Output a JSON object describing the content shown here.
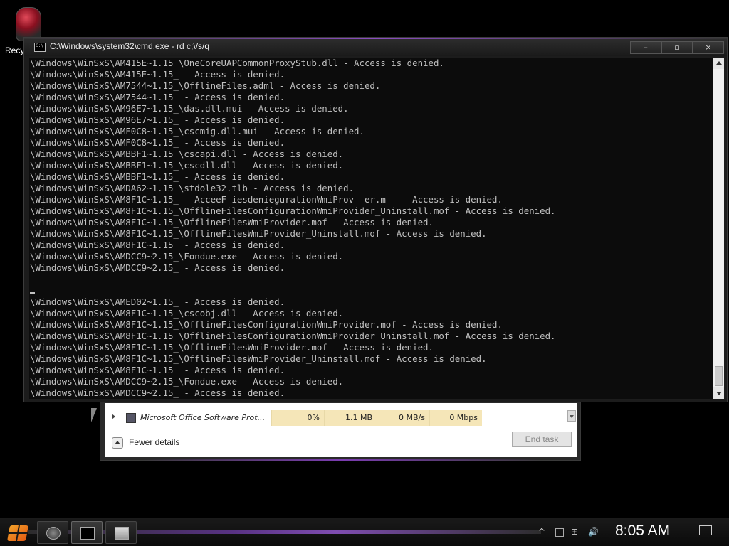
{
  "desktop": {
    "icon_label": "Recy"
  },
  "cmd": {
    "title": "C:\\Windows\\system32\\cmd.exe - rd  c;\\/s/q",
    "minimize": "–",
    "maximize": "▫",
    "close": "×",
    "lines": [
      "\\Windows\\WinSxS\\AM415E~1.15_\\OneCoreUAPCommonProxyStub.dll - Access is denied.",
      "\\Windows\\WinSxS\\AM415E~1.15_ - Access is denied.",
      "\\Windows\\WinSxS\\AM7544~1.15_\\OfflineFiles.adml - Access is denied.",
      "\\Windows\\WinSxS\\AM7544~1.15_ - Access is denied.",
      "\\Windows\\WinSxS\\AM96E7~1.15_\\das.dll.mui - Access is denied.",
      "\\Windows\\WinSxS\\AM96E7~1.15_ - Access is denied.",
      "\\Windows\\WinSxS\\AMF0C8~1.15_\\cscmig.dll.mui - Access is denied.",
      "\\Windows\\WinSxS\\AMF0C8~1.15_ - Access is denied.",
      "\\Windows\\WinSxS\\AMBBF1~1.15_\\cscapi.dll - Access is denied.",
      "\\Windows\\WinSxS\\AMBBF1~1.15_\\cscdll.dll - Access is denied.",
      "\\Windows\\WinSxS\\AMBBF1~1.15_ - Access is denied.",
      "\\Windows\\WinSxS\\AMDA62~1.15_\\stdole32.tlb - Access is denied.",
      "\\Windows\\WinSxS\\AM8F1C~1.15_ - AcceeF iesdeniegurationWmiProv  er.m   - Access is denied.",
      "\\Windows\\WinSxS\\AM8F1C~1.15_\\OfflineFilesConfigurationWmiProvider_Uninstall.mof - Access is denied.",
      "\\Windows\\WinSxS\\AM8F1C~1.15_\\OfflineFilesWmiProvider.mof - Access is denied.",
      "\\Windows\\WinSxS\\AM8F1C~1.15_\\OfflineFilesWmiProvider_Uninstall.mof - Access is denied.",
      "\\Windows\\WinSxS\\AM8F1C~1.15_ - Access is denied.",
      "\\Windows\\WinSxS\\AMDCC9~2.15_\\Fondue.exe - Access is denied.",
      "\\Windows\\WinSxS\\AMDCC9~2.15_ - Access is denied.",
      "",
      "",
      "\\Windows\\WinSxS\\AMED02~1.15_ - Access is denied.",
      "\\Windows\\WinSxS\\AM8F1C~1.15_\\cscobj.dll - Access is denied.",
      "\\Windows\\WinSxS\\AM8F1C~1.15_\\OfflineFilesConfigurationWmiProvider.mof - Access is denied.",
      "\\Windows\\WinSxS\\AM8F1C~1.15_\\OfflineFilesConfigurationWmiProvider_Uninstall.mof - Access is denied.",
      "\\Windows\\WinSxS\\AM8F1C~1.15_\\OfflineFilesWmiProvider.mof - Access is denied.",
      "\\Windows\\WinSxS\\AM8F1C~1.15_\\OfflineFilesWmiProvider_Uninstall.mof - Access is denied.",
      "\\Windows\\WinSxS\\AM8F1C~1.15_ - Access is denied.",
      "\\Windows\\WinSxS\\AMDCC9~2.15_\\Fondue.exe - Access is denied.",
      "\\Windows\\WinSxS\\AMDCC9~2.15_ - Access is denied.",
      ""
    ],
    "cursor_lines": [
      20,
      30
    ]
  },
  "taskmgr": {
    "row": {
      "name": "Microsoft Office Software Prot...",
      "cpu": "0%",
      "memory": "1.1 MB",
      "disk": "0 MB/s",
      "network": "0 Mbps"
    },
    "fewer_details": "Fewer details",
    "end_task": "End task"
  },
  "taskbar": {
    "clock": "8:05 AM",
    "tray_up": "^",
    "tray_network": "⊞",
    "tray_volume": "🔊"
  }
}
